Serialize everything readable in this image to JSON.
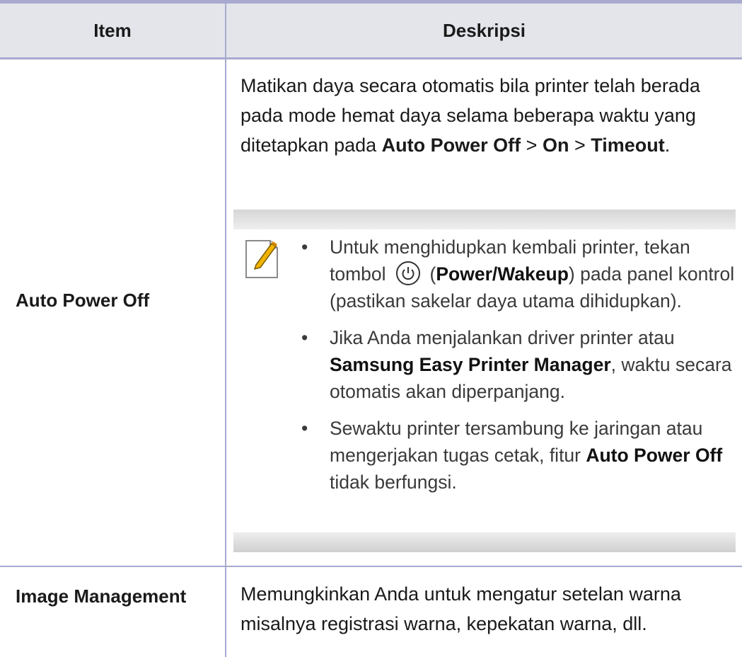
{
  "table": {
    "headers": [
      "Item",
      "Deskripsi"
    ],
    "rows": [
      {
        "item": "Auto Power Off",
        "description": {
          "text1": "Matikan daya secara otomatis bila printer telah berada pada mode hemat daya selama beberapa waktu yang ditetapkan pada ",
          "bold1": "Auto Power Off",
          "sep1": " > ",
          "bold2": "On",
          "sep2": " > ",
          "bold3": "Timeout",
          "end": "."
        },
        "note": {
          "icon": "note-pencil-icon",
          "bullets": [
            {
              "t1": "Untuk menghidupkan kembali printer, tekan tombol",
              "icon": "power-icon",
              "t2": "(",
              "b1": "Power/Wakeup",
              "t3": ") pada panel kontrol (pastikan sakelar daya utama dihidupkan)."
            },
            {
              "t1": "Jika Anda menjalankan driver printer atau ",
              "b1": "Samsung Easy Printer Manager",
              "t2": ", waktu secara otomatis akan diperpanjang."
            },
            {
              "t1": "Sewaktu printer tersambung ke jaringan atau mengerjakan tugas cetak, fitur ",
              "b1": "Auto Power Off",
              "t2": " tidak berfungsi."
            }
          ]
        }
      },
      {
        "item": "Image Management",
        "description": "Memungkinkan Anda untuk mengatur setelan warna misalnya registrasi warna, kepekatan warna, dll."
      }
    ]
  },
  "colors": {
    "rule": "#a8aad0",
    "header_bg": "#e4e5ea",
    "note_band": "#d6d6d6",
    "icon_accent": "#f0b400"
  }
}
